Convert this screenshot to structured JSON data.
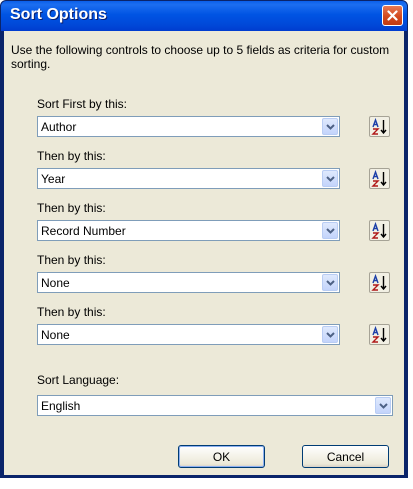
{
  "dialog": {
    "title": "Sort Options",
    "description": "Use the following controls to choose up to 5 fields as criteria for custom sorting."
  },
  "sort_fields": [
    {
      "label": "Sort First by this:",
      "value": "Author"
    },
    {
      "label": "Then by this:",
      "value": "Year"
    },
    {
      "label": "Then by this:",
      "value": "Record Number"
    },
    {
      "label": "Then by this:",
      "value": "None"
    },
    {
      "label": "Then by this:",
      "value": "None"
    }
  ],
  "sort_order_icon": "sort-ascending-az-icon",
  "language": {
    "label": "Sort Language:",
    "value": "English"
  },
  "buttons": {
    "ok": "OK",
    "cancel": "Cancel"
  },
  "colors": {
    "titlebar": "#0054e3",
    "client_bg": "#ece9d8",
    "close_button": "#d34a1f",
    "field_border": "#7f9db9"
  }
}
